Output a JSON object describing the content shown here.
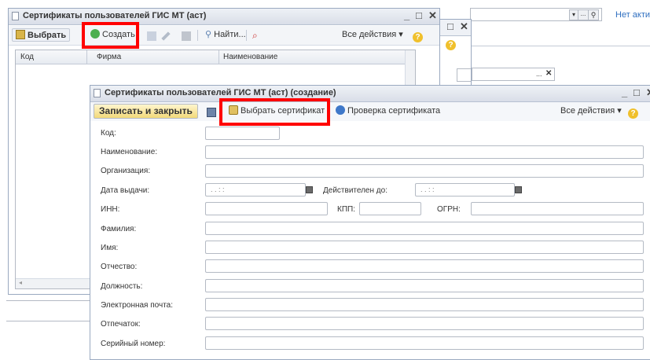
{
  "bg_right": {
    "link_text": "Нет акти"
  },
  "win1": {
    "title": "Сертификаты пользователей ГИС МТ (аст)",
    "toolbar": {
      "select": "Выбрать",
      "create": "Создать",
      "find": "Найти...",
      "all_actions": "Все действия ▾",
      "help": "?"
    },
    "columns": [
      "Код",
      "Фирма",
      "Наименование"
    ]
  },
  "win3": {
    "title": "Сертификаты пользователей ГИС МТ (аст) (создание)",
    "toolbar": {
      "save_close": "Записать и закрыть",
      "choose_cert": "Выбрать сертификат",
      "check_cert": "Проверка сертификата",
      "all_actions": "Все действия ▾",
      "help": "?"
    },
    "form": {
      "code": "Код:",
      "name": "Наименование:",
      "org": "Организация:",
      "issue_date": "Дата выдачи:",
      "issue_date_value": ". .   : :",
      "valid_to": "Действителен до:",
      "valid_to_value": ". .   : :",
      "inn": "ИНН:",
      "kpp": "КПП:",
      "ogrn": "ОГРН:",
      "surname": "Фамилия:",
      "firstname": "Имя:",
      "patronymic": "Отчество:",
      "position": "Должность:",
      "email": "Электронная почта:",
      "thumbprint": "Отпечаток:",
      "serial": "Серийный номер:"
    }
  },
  "colors": {
    "highlight": "#ff0000",
    "accent": "#2f6fc0"
  }
}
